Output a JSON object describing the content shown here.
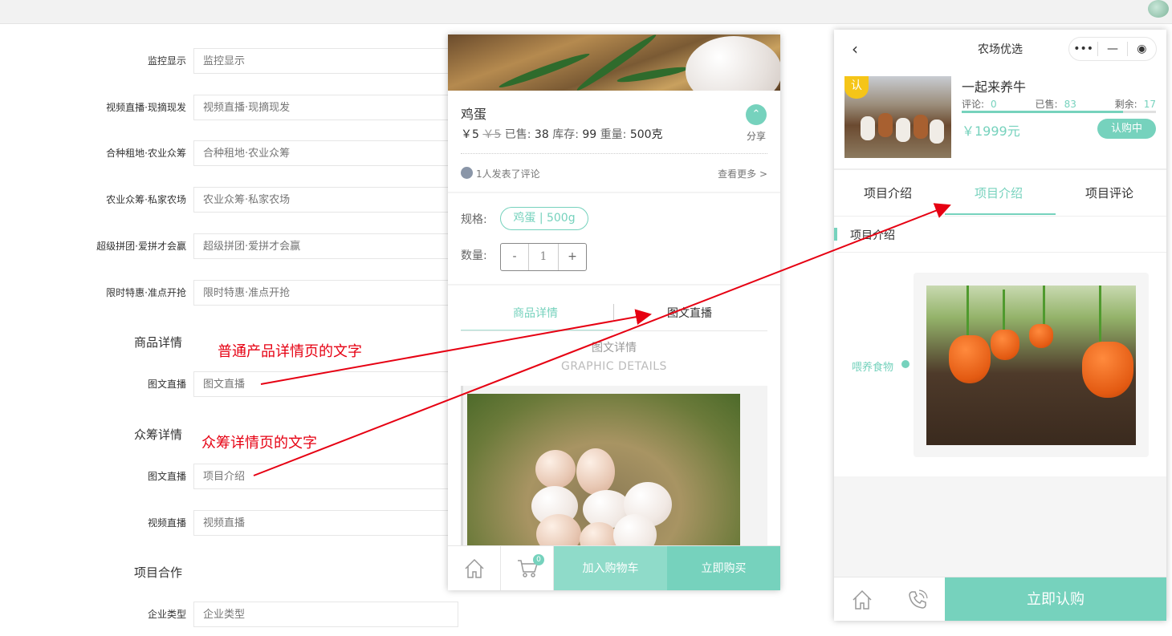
{
  "admin_form": {
    "rows": [
      {
        "label": "监控显示",
        "placeholder": "监控显示"
      },
      {
        "label": "视频直播·现摘现发",
        "placeholder": "视频直播·现摘现发"
      },
      {
        "label": "合种租地·农业众筹",
        "placeholder": "合种租地·农业众筹"
      },
      {
        "label": "农业众筹·私家农场",
        "placeholder": "农业众筹·私家农场"
      },
      {
        "label": "超级拼团·爱拼才会赢",
        "placeholder": "超级拼团·爱拼才会赢"
      },
      {
        "label": "限时特惠·准点开抢",
        "placeholder": "限时特惠·准点开抢"
      }
    ],
    "section_product": "商品详情",
    "product_row": {
      "label": "图文直播",
      "placeholder": "图文直播"
    },
    "section_crowd": "众筹详情",
    "crowd_rows": [
      {
        "label": "图文直播",
        "placeholder": "项目介绍"
      },
      {
        "label": "视频直播",
        "placeholder": "视频直播"
      }
    ],
    "section_coop": "项目合作",
    "coop_row": {
      "label": "企业类型",
      "placeholder": "企业类型"
    }
  },
  "annotations": {
    "product_note": "普通产品详情页的文字",
    "crowd_note": "众筹详情页的文字"
  },
  "product_phone": {
    "name": "鸡蛋",
    "price": "￥5",
    "orig_price": "￥5",
    "sold_label": "已售:",
    "sold": "38",
    "stock_label": "库存:",
    "stock": "99",
    "weight_label": "重量:",
    "weight": "500克",
    "share": "分享",
    "share_glyph": "⌃",
    "comment": "1人发表了评论",
    "more": "查看更多 >",
    "spec_label": "规格:",
    "spec_value": "鸡蛋 | 500g",
    "qty_label": "数量:",
    "qty_minus": "-",
    "qty_value": "1",
    "qty_plus": "+",
    "tabs": [
      "商品详情",
      "图文直播"
    ],
    "detail_title": "图文详情",
    "detail_sub": "GRAPHIC DETAILS",
    "cart_count": "0",
    "add_cart": "加入购物车",
    "buy_now": "立即购买",
    "icons": {
      "home": "home-icon",
      "cart": "cart-icon",
      "share": "share-icon"
    }
  },
  "crowd_phone": {
    "nav_title": "农场优选",
    "back_glyph": "‹",
    "capsule": [
      "•••",
      "—",
      "◉"
    ],
    "badge": "认",
    "project_name": "一起来养牛",
    "stats": [
      {
        "label": "评论:",
        "value": "0"
      },
      {
        "label": "已售:",
        "value": "83"
      },
      {
        "label": "剩余:",
        "value": "17"
      }
    ],
    "progress_pct": 83,
    "price": "￥1999元",
    "status": "认购中",
    "tabs": [
      "项目介绍",
      "项目介绍",
      "项目评论"
    ],
    "active_tab": 1,
    "section_title": "项目介绍",
    "feed_label": "喂养食物",
    "subscribe": "立即认购",
    "colors": {
      "accent": "#76d2bd",
      "badge": "#f5c518",
      "annotation": "#e60012"
    }
  }
}
